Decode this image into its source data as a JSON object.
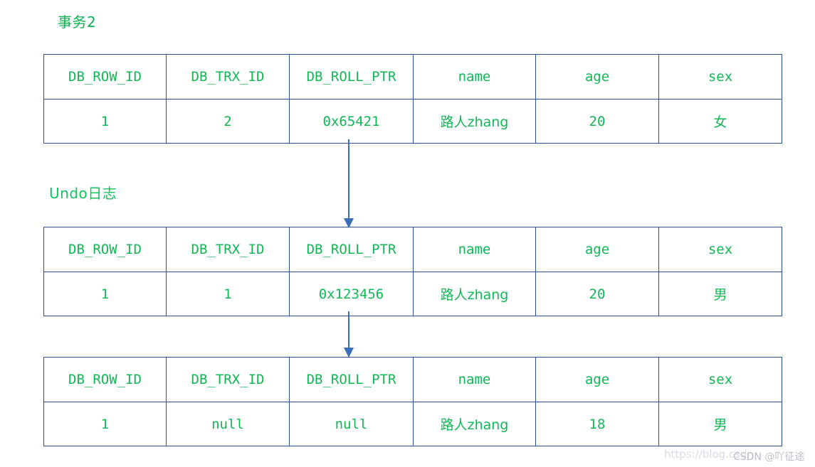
{
  "diagram": {
    "title_label": "事务2",
    "undo_label": "Undo日志",
    "colors": {
      "text_green": "#12b755",
      "title_green": "#0fb051",
      "border_blue": "#2a4f91",
      "arrow_blue": "#3a6fb7",
      "background": "#ffffff"
    },
    "columns": [
      "DB_ROW_ID",
      "DB_TRX_ID",
      "DB_ROLL_PTR",
      "name",
      "age",
      "sex"
    ],
    "tables": [
      {
        "id": "current-row",
        "headers": [
          "DB_ROW_ID",
          "DB_TRX_ID",
          "DB_ROLL_PTR",
          "name",
          "age",
          "sex"
        ],
        "values": [
          "1",
          "2",
          "0x65421",
          "路人zhang",
          "20",
          "女"
        ]
      },
      {
        "id": "undo-log-entry-1",
        "headers": [
          "DB_ROW_ID",
          "DB_TRX_ID",
          "DB_ROLL_PTR",
          "name",
          "age",
          "sex"
        ],
        "values": [
          "1",
          "1",
          "0x123456",
          "路人zhang",
          "20",
          "男"
        ]
      },
      {
        "id": "undo-log-entry-2",
        "headers": [
          "DB_ROW_ID",
          "DB_TRX_ID",
          "DB_ROLL_PTR",
          "name",
          "age",
          "sex"
        ],
        "values": [
          "1",
          "null",
          "null",
          "路人zhang",
          "18",
          "男"
        ]
      }
    ],
    "arrows": [
      {
        "id": "arrow-table1-to-table2",
        "direction": "down"
      },
      {
        "id": "arrow-table2-to-table3",
        "direction": "down"
      }
    ]
  },
  "watermark": {
    "url": "https://blog.csdn",
    "author": "CSDN @吖征途"
  }
}
